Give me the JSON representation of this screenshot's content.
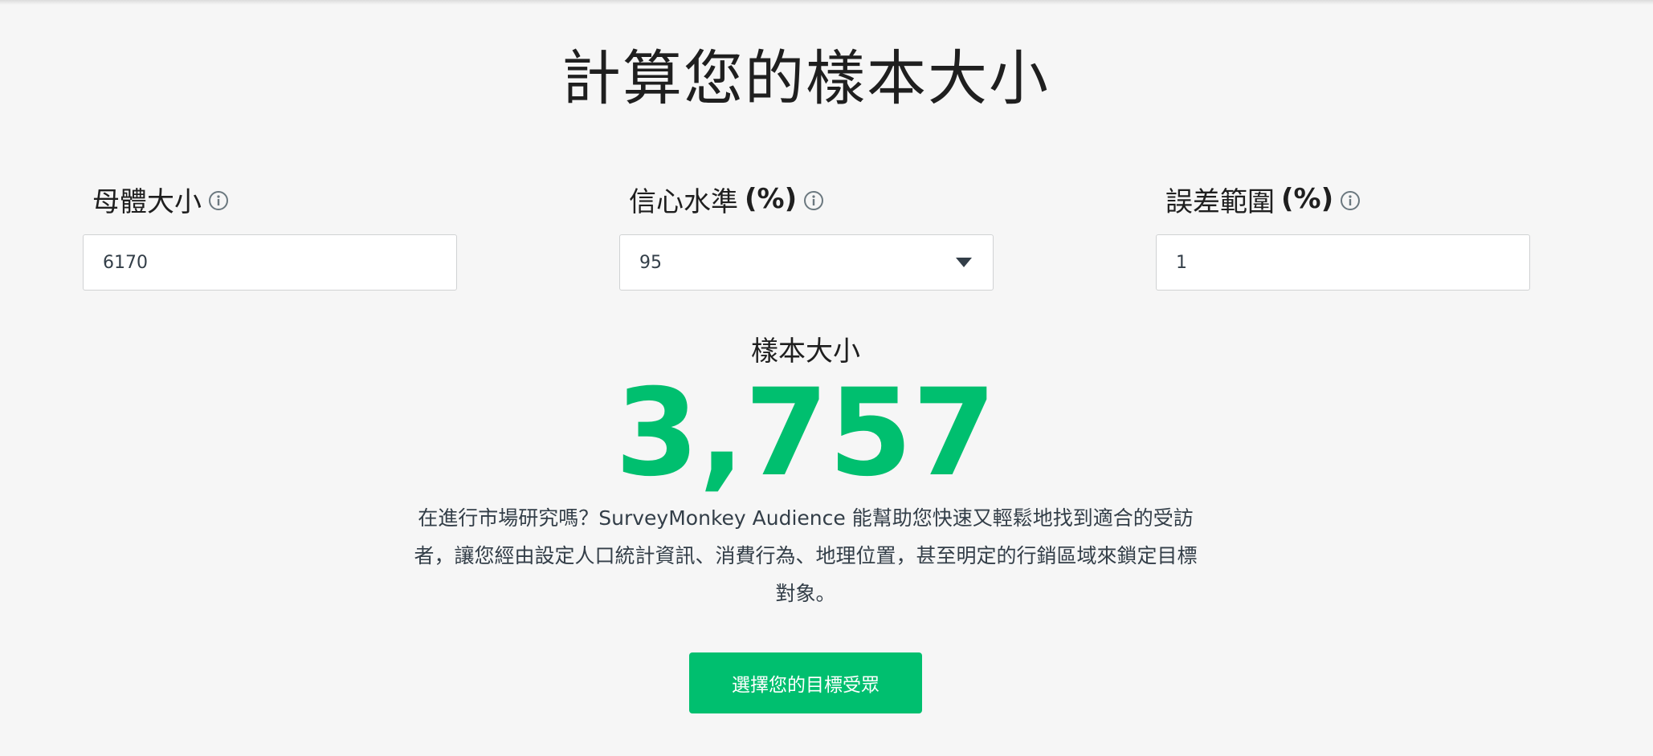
{
  "page": {
    "title": "計算您的樣本大小"
  },
  "fields": {
    "population": {
      "label": "母體大小",
      "unit": "",
      "value": "6170"
    },
    "confidence": {
      "label": "信心水準",
      "unit": "(%)",
      "selected": "95"
    },
    "margin": {
      "label": "誤差範圍",
      "unit": "(%)",
      "value": "1"
    }
  },
  "result": {
    "label": "樣本大小",
    "value": "3,757"
  },
  "description": "在進行市場研究嗎？SurveyMonkey Audience 能幫助您快速又輕鬆地找到適合的受訪者，讓您經由設定人口統計資訊、消費行為、地理位置，甚至明定的行銷區域來鎖定目標對象。",
  "cta": {
    "label": "選擇您的目標受眾"
  },
  "colors": {
    "accent": "#00bf6f",
    "background": "#f6f6f6",
    "text": "#333e48"
  },
  "icons": {
    "info": "info-circle-icon",
    "dropdown": "caret-down-icon"
  }
}
